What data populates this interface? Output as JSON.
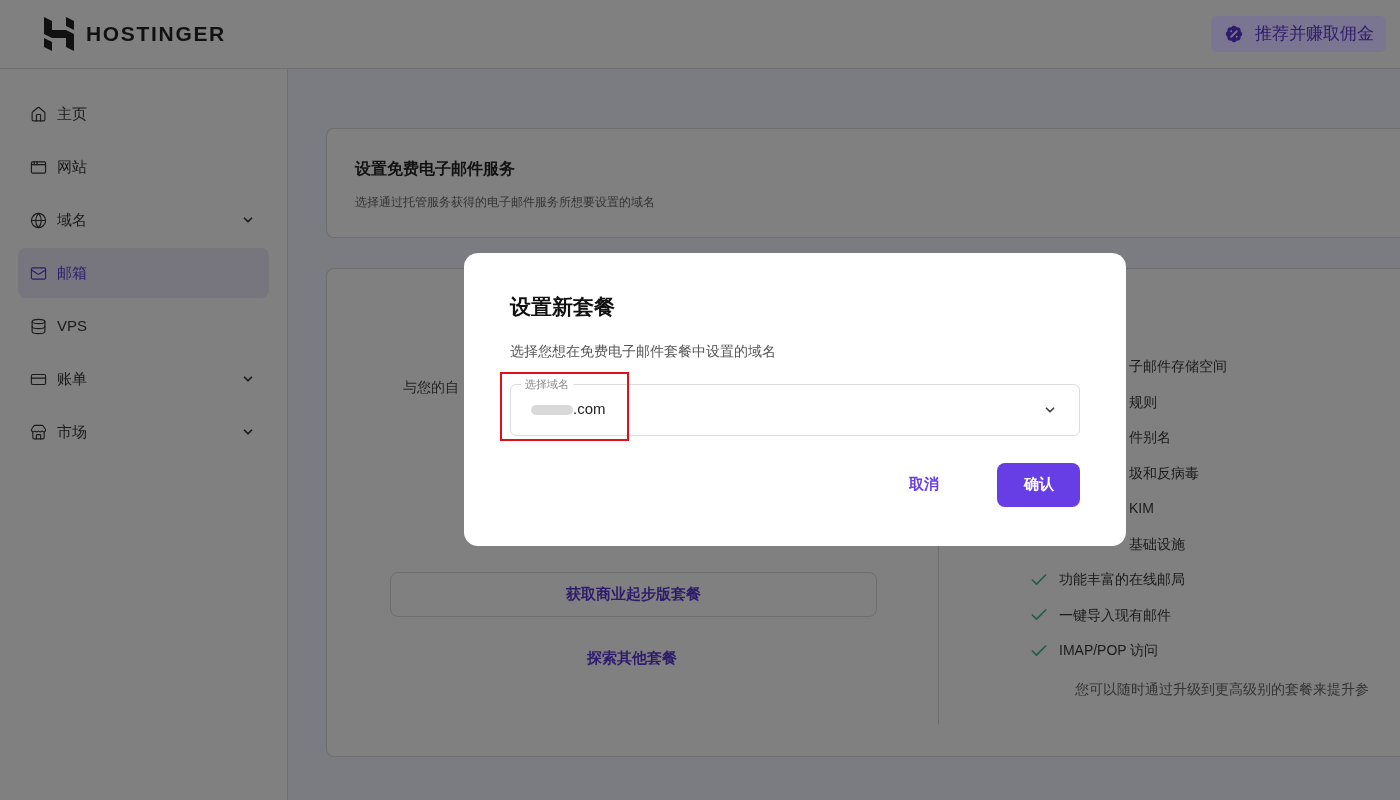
{
  "header": {
    "brand": "HOSTINGER",
    "referral_button": "推荐并赚取佣金"
  },
  "sidebar": {
    "items": [
      {
        "label": "主页",
        "expandable": false,
        "selected": false
      },
      {
        "label": "网站",
        "expandable": false,
        "selected": false
      },
      {
        "label": "域名",
        "expandable": true,
        "selected": false
      },
      {
        "label": "邮箱",
        "expandable": false,
        "selected": true
      },
      {
        "label": "VPS",
        "expandable": false,
        "selected": false
      },
      {
        "label": "账单",
        "expandable": true,
        "selected": false
      },
      {
        "label": "市场",
        "expandable": true,
        "selected": false
      }
    ]
  },
  "intro_card": {
    "title": "设置免费电子邮件服务",
    "subtitle": "选择通过托管服务获得的电子邮件服务所想要设置的域名"
  },
  "plan_card": {
    "intro": "与您的自",
    "primary_button": "获取商业起步版套餐",
    "secondary_link": "探索其他套餐",
    "features": [
      {
        "text": "子邮件存储空间",
        "kind": "partial"
      },
      {
        "text": "规则",
        "kind": "partial"
      },
      {
        "text": "件别名",
        "kind": "partial"
      },
      {
        "text": "圾和反病毒",
        "kind": "partial"
      },
      {
        "text": "KIM",
        "kind": "partial"
      },
      {
        "text": "基础设施",
        "kind": "partial"
      },
      {
        "text": "功能丰富的在线邮局",
        "kind": "full"
      },
      {
        "text": "一键导入现有邮件",
        "kind": "full"
      },
      {
        "text": "IMAP/POP 访问",
        "kind": "full"
      }
    ],
    "footnote": "您可以随时通过升级到更高级别的套餐来提升参"
  },
  "dialog": {
    "title": "设置新套餐",
    "subtitle": "选择您想在免费电子邮件套餐中设置的域名",
    "field": {
      "label": "选择域名",
      "value": ".com",
      "redacted": true
    },
    "highlighted": true,
    "cancel": "取消",
    "confirm": "确认"
  }
}
